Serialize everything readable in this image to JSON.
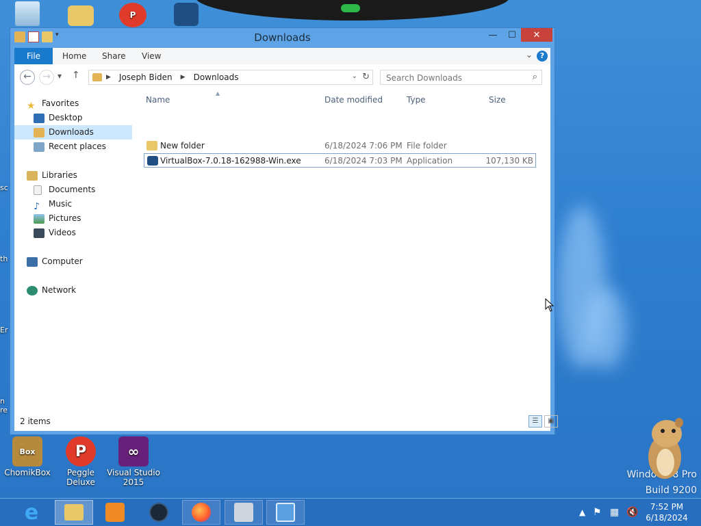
{
  "desktop": {
    "icons": [
      {
        "label": "ChomikBox",
        "icon": "chomikbox-icon"
      },
      {
        "label": "Peggle Deluxe",
        "icon": "peggle-icon"
      },
      {
        "label": "Visual Studio 2015",
        "icon": "visual-studio-icon"
      }
    ],
    "watermark_line1": "Windows 8 Pro",
    "watermark_line2": "Build 9200"
  },
  "window": {
    "title": "Downloads",
    "controls": {
      "minimize": "—",
      "maximize": "☐",
      "close": "✕"
    },
    "ribbon_tabs": [
      "File",
      "Home",
      "Share",
      "View"
    ],
    "breadcrumb": [
      "Joseph Biden",
      "Downloads"
    ],
    "search_placeholder": "Search Downloads",
    "nav_pane": {
      "favorites": {
        "label": "Favorites",
        "items": [
          "Desktop",
          "Downloads",
          "Recent places"
        ]
      },
      "libraries": {
        "label": "Libraries",
        "items": [
          "Documents",
          "Music",
          "Pictures",
          "Videos"
        ]
      },
      "computer": "Computer",
      "network": "Network"
    },
    "columns": {
      "name": "Name",
      "date": "Date modified",
      "type": "Type",
      "size": "Size"
    },
    "files": [
      {
        "name": "New folder",
        "date": "6/18/2024 7:06 PM",
        "type": "File folder",
        "size": ""
      },
      {
        "name": "VirtualBox-7.0.18-162988-Win.exe",
        "date": "6/18/2024 7:03 PM",
        "type": "Application",
        "size": "107,130 KB"
      }
    ],
    "status": "2 items"
  },
  "taskbar": {
    "apps": [
      "internet-explorer-icon",
      "file-explorer-icon",
      "media-player-icon",
      "obs-icon",
      "firefox-icon",
      "installer-icon",
      "control-panel-icon"
    ],
    "clock_time": "7:52 PM",
    "clock_date": "6/18/2024"
  },
  "colors": {
    "accent": "#1979ca",
    "close": "#c7423a",
    "selection": "#cce8ff",
    "wallpaper": "#2f7fd0"
  }
}
